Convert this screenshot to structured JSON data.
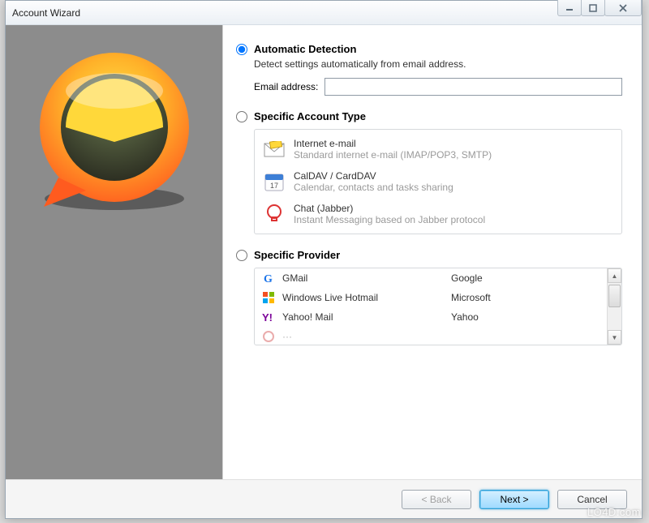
{
  "window": {
    "title": "Account Wizard"
  },
  "auto": {
    "label": "Automatic Detection",
    "desc": "Detect settings automatically from email address.",
    "email_label": "Email address:",
    "email_value": ""
  },
  "specific_type": {
    "label": "Specific Account Type",
    "items": [
      {
        "title": "Internet e-mail",
        "desc": "Standard internet e-mail (IMAP/POP3, SMTP)"
      },
      {
        "title": "CalDAV / CardDAV",
        "desc": "Calendar, contacts and tasks sharing"
      },
      {
        "title": "Chat (Jabber)",
        "desc": "Instant Messaging based on Jabber protocol"
      }
    ]
  },
  "specific_provider": {
    "label": "Specific Provider",
    "items": [
      {
        "name": "GMail",
        "company": "Google"
      },
      {
        "name": "Windows Live Hotmail",
        "company": "Microsoft"
      },
      {
        "name": "Yahoo! Mail",
        "company": "Yahoo"
      }
    ]
  },
  "buttons": {
    "back": "< Back",
    "next": "Next >",
    "cancel": "Cancel"
  },
  "watermark": "LO4D.com"
}
